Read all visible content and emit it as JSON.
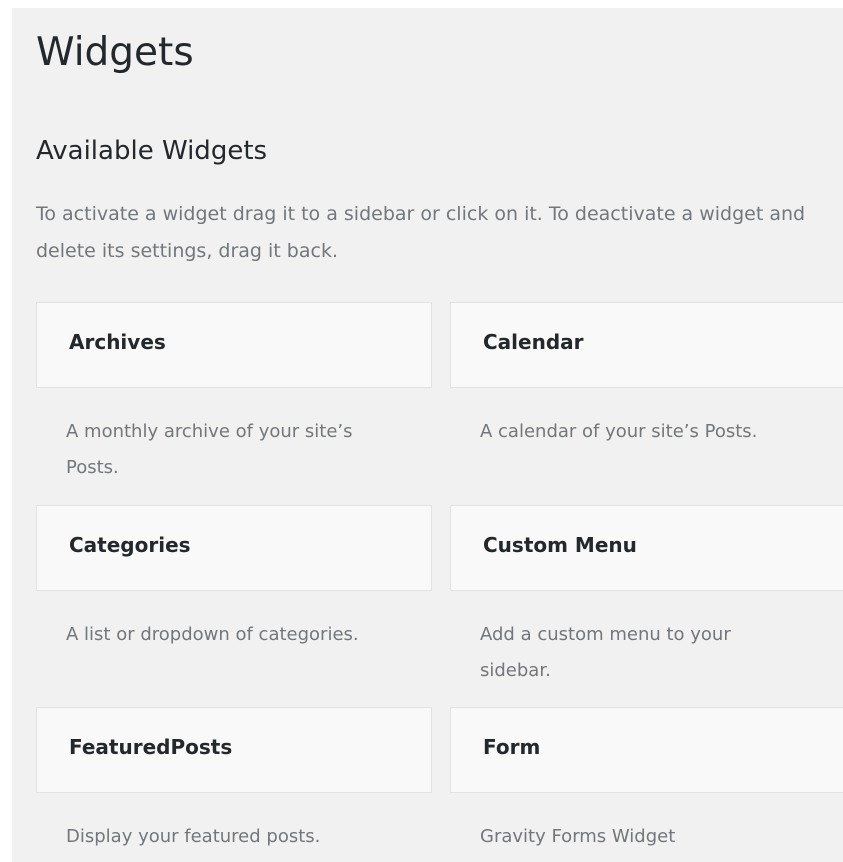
{
  "page": {
    "title": "Widgets"
  },
  "available": {
    "heading": "Available Widgets",
    "description": "To activate a widget drag it to a sidebar or click on it. To deactivate a widget and delete its settings, drag it back."
  },
  "widgets": [
    {
      "title": "Archives",
      "description": "A monthly archive of your site’s Posts."
    },
    {
      "title": "Calendar",
      "description": "A calendar of your site’s Posts."
    },
    {
      "title": "Categories",
      "description": "A list or dropdown of categories."
    },
    {
      "title": "Custom Menu",
      "description": "Add a custom menu to your sidebar."
    },
    {
      "title": "FeaturedPosts",
      "description": "Display your featured posts."
    },
    {
      "title": "Form",
      "description": "Gravity Forms Widget"
    }
  ],
  "colors": {
    "page_background": "#f1f1f1",
    "widget_background": "#f9f9f9",
    "widget_border": "#e2e2e2",
    "heading_text": "#23282d",
    "muted_text": "#72777c"
  }
}
